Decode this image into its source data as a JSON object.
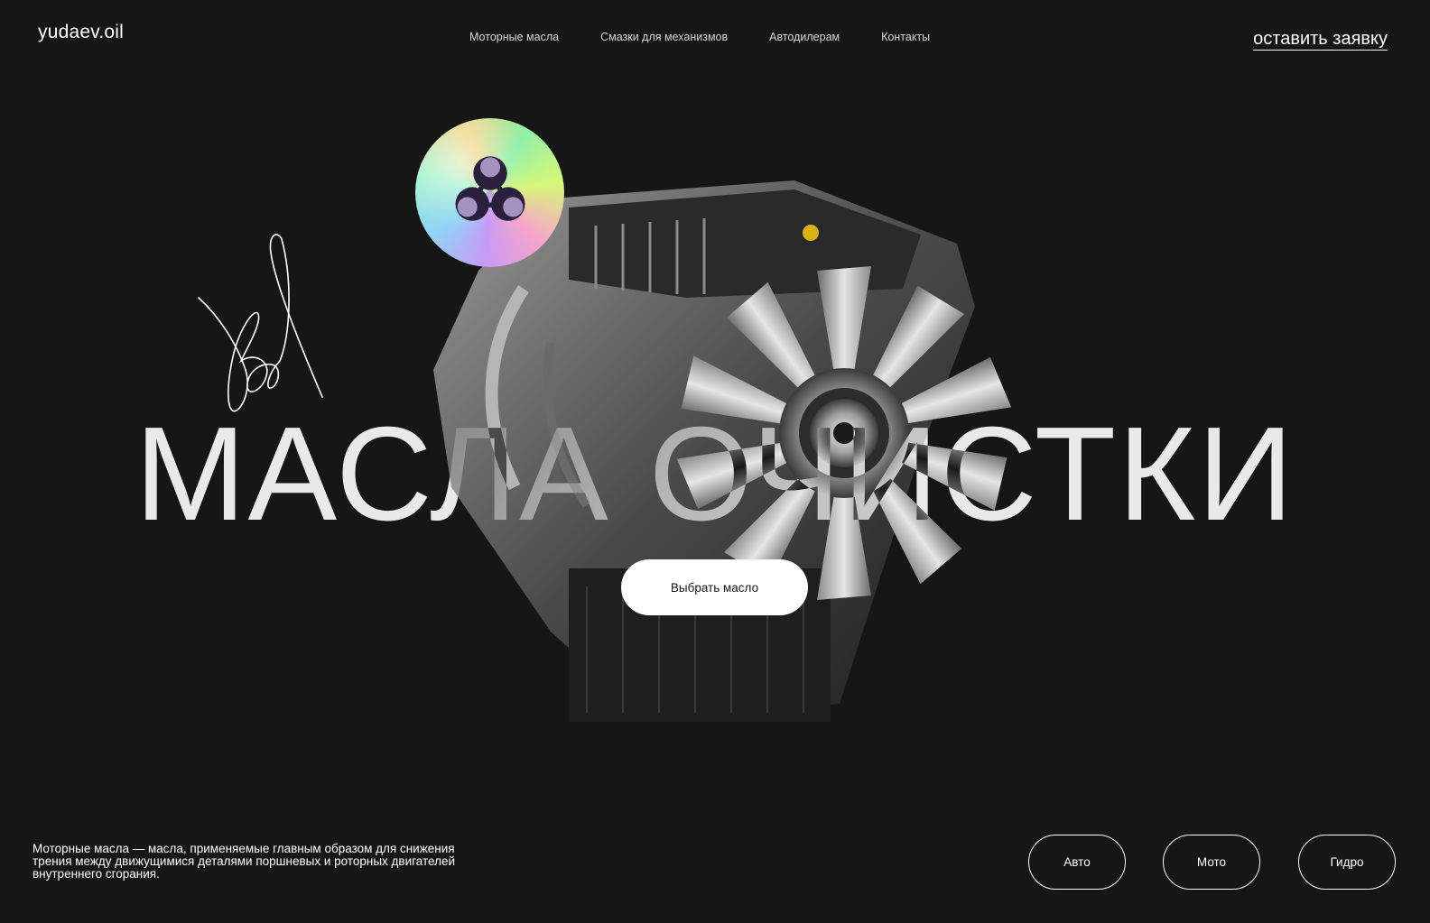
{
  "header": {
    "logo": "yudaev.oil",
    "nav": [
      {
        "label": "Моторные масла"
      },
      {
        "label": "Смазки для механизмов"
      },
      {
        "label": "Автодилерам"
      },
      {
        "label": "Контакты"
      }
    ],
    "cta": "оставить заявку"
  },
  "hero": {
    "headline": "МАСЛА ОЧИСТКИ",
    "button": "Выбрать масло",
    "badge_icon": "biohazard-icon",
    "engine_icon": "engine-image"
  },
  "footer": {
    "description": "Моторные масла — масла, применяемые главным образом для снижения трения между движущимися деталями поршневых и роторных двигателей внутреннего сгорания.",
    "categories": [
      {
        "label": "Авто"
      },
      {
        "label": "Мото"
      },
      {
        "label": "Гидро"
      }
    ]
  },
  "colors": {
    "background": "#161616",
    "text": "#ffffff",
    "button_bg": "#ffffff",
    "button_text": "#161616"
  }
}
